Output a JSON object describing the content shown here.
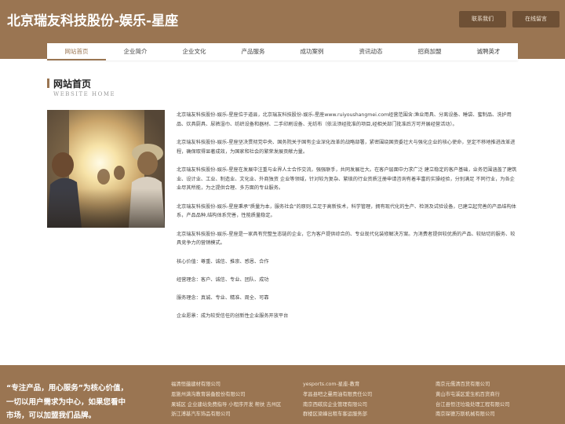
{
  "header": {
    "site_title": "北京瑞友科技股份-娱乐-星座",
    "contact_button": "联系我们",
    "message_button": "在线留言"
  },
  "nav": {
    "items": [
      "网站首页",
      "企业简介",
      "企业文化",
      "产品服务",
      "成功案例",
      "资讯动态",
      "招商加盟",
      "诚聘英才"
    ],
    "active_index": 0
  },
  "section": {
    "title": "网站首页",
    "subtitle": "WEBSITE HOME"
  },
  "content": {
    "paragraphs": [
      "北京瑞友科技股份-娱乐-星座位于道县，北京瑞友科技股份-娱乐-星座www.ruiyoushangmei.com经营范围含:渔业用具、分离设备、睡袋、蜜制品、洗护用品、炊具厨具、尿裤湿巾、纺织设备和器材、二手印刷设备、无纺布（依法须经批准的项目,经相关部门批准后方可开展经营活动）。",
      "北京瑞友科技股份-娱乐-星座坚决贯彻党中央、国务院关于国有企业深化改革的战略部署，紧密围绕国资委壮大与强化企业的核心使命，坚定不移地推进改革进程，确保取得显著成效，为国家和社会的繁荣发展贡献力量。",
      "北京瑞友科技股份-娱乐-星座在发展中注重与业界人士合作交流，强强联手，共同发展壮大。在客户层面中力求广泛 建立稳定的客户基础，业务范围涵盖了建筑业、设计业、工业、制造业、文化业、外商独资 企业等领域，针对较为复杂、繁琐的行业资质注册申请咨询有着丰富的实操经验，分别满足 不同行业，为各企业尽其所能，为之提供合理、多方面的专业服务。",
      "北京瑞友科技股份-娱乐-星座秉承\"质量为本，服务社会\"的原则,立足于高新技术，科学管理，拥有现代化的生产、检测及试验设备，已建立起完善的产品结构体系，产品品种,结构体系完善，性能质量稳定。",
      "北京瑞友科技股份-娱乐-星座是一家具有完整生态链的企业，它为客户提供综合的、专业现代化装修解决方案。为消费者提供较优质的产品、较贴切的服务、较具竞争力的营销模式。"
    ],
    "values": [
      "核心价值：尊重、诚信、推崇、感恩、合作",
      "经营理念：客户、诚信、专业、团队、成功",
      "服务理念：真诚、专业、精准、周全、可靠",
      "企业愿景：成为较受信任的创新性企业服务开放平台"
    ]
  },
  "footer": {
    "slogan": "“专注产品，用心服务”为核心价值，一切以用户需求为中心，如果您看中市场，可以加盟我们品牌。",
    "links_col1": [
      "福清恒蕴建材有限公司",
      "恩施州满沟教育装备股份有限公司",
      "果城区 企业建站免费指导 小程序开发 帮扶 吉州区",
      "浙江溥基汽车饰品有限公司"
    ],
    "links_col2": [
      "yesports.com-星座-教育",
      "孝昌县吧之曼用油有限责任公司",
      "南京西碳房企业管理有限公司",
      "群楼区梁峰出租车客运服务部"
    ],
    "links_col3": [
      "南京元儒清百货有限公司",
      "黄山市屯溪区爱生机百货商行",
      "台江县恒汪垃圾处理工程有限公司",
      "南京琛德万斯机械有限公司"
    ]
  },
  "colors": {
    "brand": "#9a7552",
    "header_button": "#6e5035"
  }
}
